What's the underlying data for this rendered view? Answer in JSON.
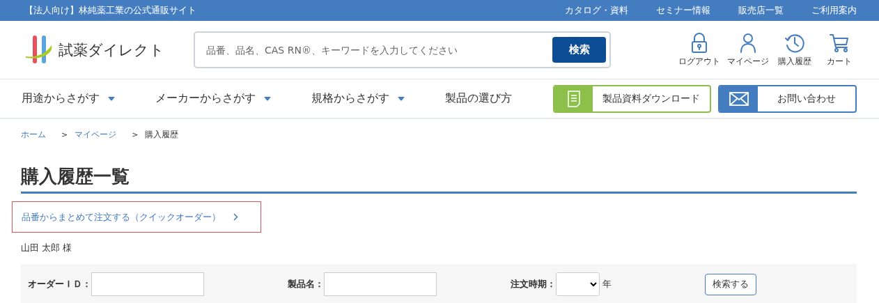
{
  "top_bar": {
    "tagline": "【法人向け】林純薬工業の公式通販サイト",
    "links": [
      "カタログ・資料",
      "セミナー情報",
      "販売店一覧",
      "ご利用案内"
    ]
  },
  "header": {
    "logo_text": "試薬ダイレクト",
    "search": {
      "placeholder": "品番、品名、CAS RN®、キーワードを入力してください",
      "button": "検索"
    },
    "icons": [
      {
        "kind": "lock",
        "label": "ログアウト"
      },
      {
        "kind": "person",
        "label": "マイページ"
      },
      {
        "kind": "history",
        "label": "購入履歴"
      },
      {
        "kind": "cart",
        "label": "カート"
      }
    ]
  },
  "nav": {
    "items": [
      {
        "label": "用途からさがす",
        "has_menu": true
      },
      {
        "label": "メーカーからさがす",
        "has_menu": true
      },
      {
        "label": "規格からさがす",
        "has_menu": true
      },
      {
        "label": "製品の選び方",
        "has_menu": false
      }
    ],
    "buttons": [
      {
        "kind": "document",
        "label": "製品資料ダウンロード"
      },
      {
        "kind": "mail",
        "label": "お問い合わせ"
      }
    ]
  },
  "breadcrumb": [
    {
      "label": "ホーム",
      "current": false
    },
    {
      "separator": ">",
      "label": "マイページ",
      "current": false
    },
    {
      "separator": ">",
      "label": "購入履歴",
      "current": true
    }
  ],
  "page_title": "購入履歴一覧",
  "quick_order_link": "品番からまとめて注文する（クイックオーダー）",
  "customer_name": "山田 太郎 様",
  "filter": {
    "order_id_label": "オーダーＩＤ：",
    "product_label": "製品名：",
    "period_label": "注文時期：",
    "year_unit": "年",
    "button": "検索する"
  }
}
